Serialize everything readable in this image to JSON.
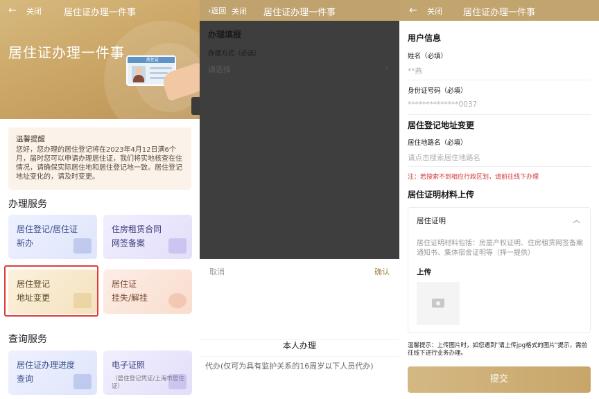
{
  "panel1": {
    "nav": {
      "back": "←",
      "close": "关闭",
      "title": "居住证办理一件事"
    },
    "hero_title": "居住证办理一件事",
    "card_label": "居住证",
    "notice": {
      "title": "温馨提醒",
      "body": "您好，您办理的居住登记将在2023年4月12日满6个月，届时您可以申请办理居住证，我们将实地核查在住情况，请确保实际居住地和居住登记地一致。居住登记地址变化的，请及时变更。"
    },
    "section_service": "办理服务",
    "services": [
      {
        "l1": "居住登记/居住证",
        "l2": "新办"
      },
      {
        "l1": "住房租赁合同",
        "l2": "网签备案"
      },
      {
        "l1": "居住登记",
        "l2": "地址变更"
      },
      {
        "l1": "居住证",
        "l2": "挂失/解挂"
      }
    ],
    "section_query": "查询服务",
    "queries": [
      {
        "l1": "居住证办理进度",
        "l2": "查询"
      },
      {
        "l1": "电子证照",
        "sub": "（居住登记凭证/上海市居住证）"
      }
    ]
  },
  "panel2": {
    "nav": {
      "back": "‹返回",
      "close": "关闭",
      "title": "居住证办理一件事"
    },
    "form_title": "办理填报",
    "method_label": "办理方式（必选）",
    "method_placeholder": "请选择",
    "chevron": "›",
    "cancel": "取消",
    "confirm": "确认",
    "option_self": "本人办理",
    "option_proxy": "代办(仅可为具有监护关系的16周岁以下人员代办)"
  },
  "panel3": {
    "nav": {
      "back": "←",
      "close": "关闭",
      "title": "居住证办理一件事"
    },
    "user_info": "用户信息",
    "name_label": "姓名（必填）",
    "name_value": "**燕",
    "id_label": "身份证号码（必填）",
    "id_value": "**************0037",
    "addr_section": "居住登记地址变更",
    "road_label": "居住地路名（必填）",
    "road_placeholder": "请点击搜索居住地路名",
    "warning": "注：若搜索不到相应行政区划，请前往线下办理",
    "material_section": "居住证明材料上传",
    "card_title": "居住证明",
    "card_chevron": "︿",
    "card_desc": "居住证明材料包括：房屋产权证明、住房租赁网签备案通知书、集体宿舍证明等（择一提供）",
    "upload_label": "上传",
    "tip": "温馨提示：上传图片时，如您遇到\"请上传jpg格式的图片\"提示，需前往线下进行业务办理。",
    "submit": "提交"
  }
}
